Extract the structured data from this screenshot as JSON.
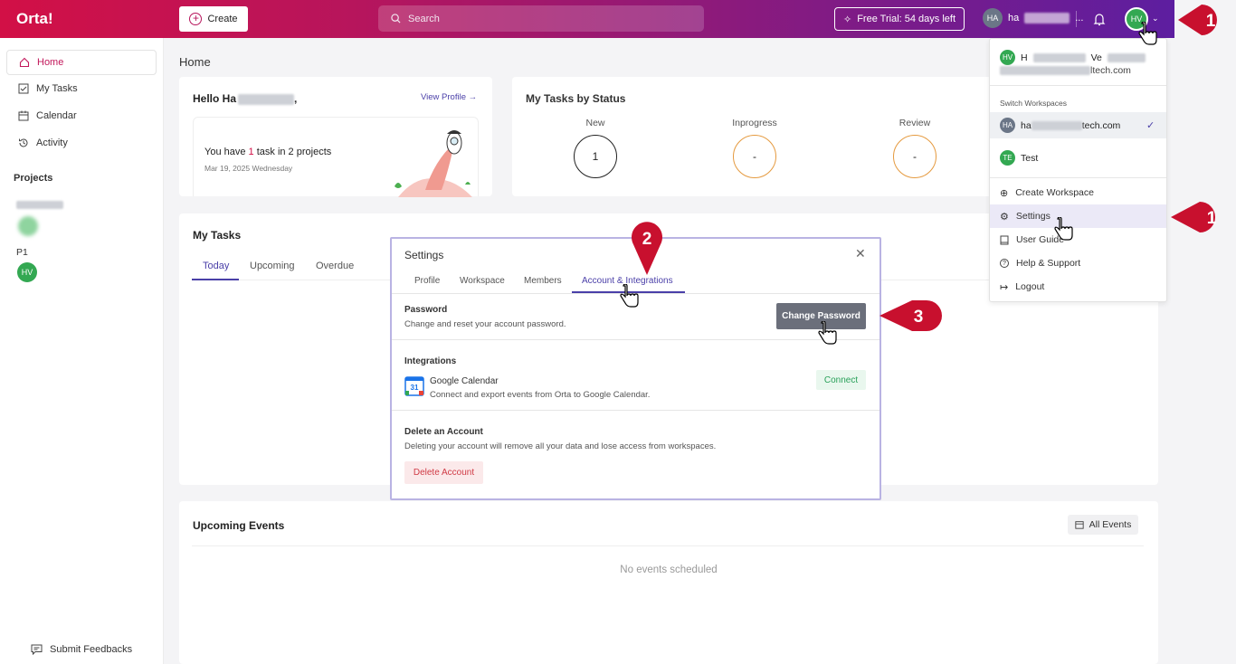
{
  "app": {
    "logo": "Orta!"
  },
  "topbar": {
    "create_label": "Create",
    "search_placeholder": "Search",
    "trial_label": "Free Trial: 54 days left",
    "workspace_initials": "HA",
    "workspace_name": "ha",
    "workspace_suffix": "...",
    "user_initials": "HV"
  },
  "sidebar": {
    "items": [
      {
        "label": "Home",
        "icon": "home-icon"
      },
      {
        "label": "My Tasks",
        "icon": "checkbox-icon"
      },
      {
        "label": "Calendar",
        "icon": "calendar-icon"
      },
      {
        "label": "Activity",
        "icon": "history-icon"
      }
    ],
    "projects_heading": "Projects",
    "project_p1": "P1",
    "project_p1_member": "HV",
    "feedback_label": "Submit Feedbacks"
  },
  "home": {
    "title": "Home",
    "hello_prefix": "Hello Ha",
    "hello_suffix": ",",
    "view_profile": "View Profile →",
    "task_prefix": "You have ",
    "task_count": "1",
    "task_suffix": " task in 2 projects",
    "task_date": "Mar 19, 2025 Wednesday"
  },
  "status": {
    "title": "My Tasks by Status",
    "items": [
      {
        "label": "New",
        "value": "1"
      },
      {
        "label": "Inprogress",
        "value": "-"
      },
      {
        "label": "Review",
        "value": "-"
      }
    ]
  },
  "mytasks": {
    "title": "My Tasks",
    "tabs": [
      "Today",
      "Upcoming",
      "Overdue"
    ]
  },
  "events": {
    "title": "Upcoming Events",
    "all_events": "All Events",
    "empty": "No events scheduled"
  },
  "settings_modal": {
    "title": "Settings",
    "tabs": [
      "Profile",
      "Workspace",
      "Members",
      "Account & Integrations"
    ],
    "password_title": "Password",
    "password_sub": "Change and reset your account password.",
    "change_password": "Change Password",
    "integrations_title": "Integrations",
    "gcal_title": "Google Calendar",
    "gcal_sub": "Connect and export events from Orta to Google Calendar.",
    "connect": "Connect",
    "gcal_day": "31",
    "delete_title": "Delete an Account",
    "delete_sub": "Deleting your account will remove all your data and lose access from workspaces.",
    "delete_button": "Delete Account"
  },
  "dropdown": {
    "user_initials": "HV",
    "user_name_start": "H",
    "user_name_mid": "Ve",
    "email_suffix": "ltech.com",
    "switch_label": "Switch Workspaces",
    "workspaces": [
      {
        "initials": "HA",
        "name_start": "ha",
        "name_end": "tech.com",
        "current": true
      },
      {
        "initials": "TE",
        "name": "Test",
        "current": false
      }
    ],
    "items": [
      {
        "label": "Create Workspace",
        "icon": "plus-circle-icon"
      },
      {
        "label": "Settings",
        "icon": "gear-icon"
      },
      {
        "label": "User Guide",
        "icon": "book-icon"
      },
      {
        "label": "Help & Support",
        "icon": "help-icon"
      },
      {
        "label": "Logout",
        "icon": "logout-icon"
      }
    ]
  },
  "callouts": [
    "1",
    "1",
    "2",
    "3"
  ],
  "colors": {
    "brand": "#d21046",
    "accent": "#4a3fa8",
    "callout": "#c8102e"
  }
}
